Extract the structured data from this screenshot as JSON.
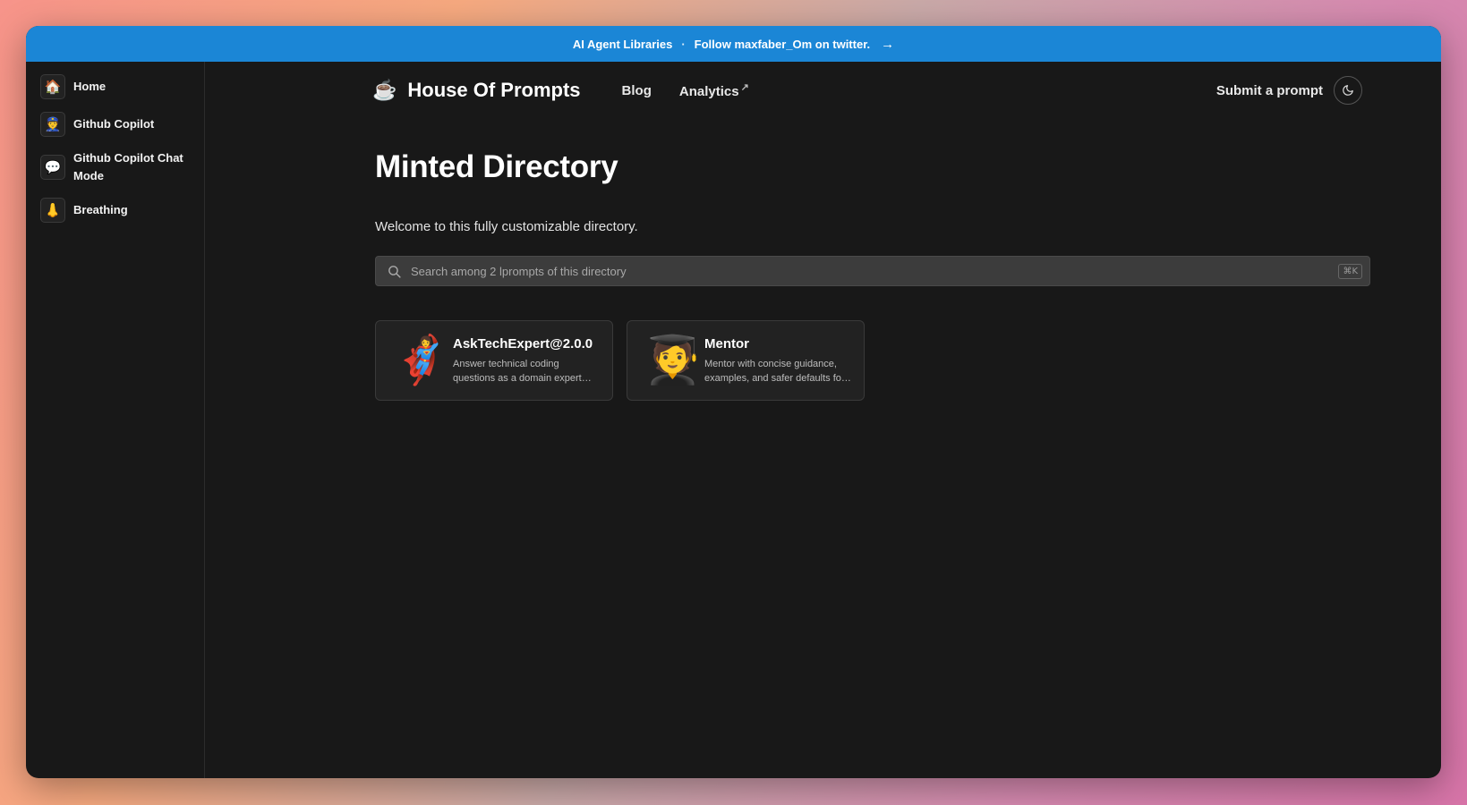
{
  "banner": {
    "library_label": "AI Agent Libraries",
    "separator": "·",
    "follow_text": "Follow maxfaber_Om on twitter.",
    "arrow": "→"
  },
  "sidebar": {
    "items": [
      {
        "icon": "🏠",
        "icon_name": "home-icon",
        "label": "Home"
      },
      {
        "icon": "👮",
        "icon_name": "copilot-icon",
        "label": "Github Copilot"
      },
      {
        "icon": "💬",
        "icon_name": "chat-bubble-icon",
        "label": "Github Copilot Chat Mode"
      },
      {
        "icon": "👃",
        "icon_name": "nose-icon",
        "label": "Breathing"
      }
    ]
  },
  "nav": {
    "brand_icon": "☕",
    "brand": "House Of Prompts",
    "links": [
      {
        "label": "Blog"
      },
      {
        "label": "Analytics",
        "external_icon": "↗"
      }
    ],
    "submit_label": "Submit a prompt",
    "theme_icon": "☾"
  },
  "main": {
    "title": "Minted Directory",
    "welcome": "Welcome to this fully customizable directory.",
    "search_placeholder": "Search among 2 lprompts of this directory",
    "search_shortcut": "⌘K"
  },
  "cards": [
    {
      "emoji": "🦸‍♀️",
      "title": "AskTechExpert@2.0.0",
      "description": "Answer technical coding questions as a domain expert with examples"
    },
    {
      "emoji": "🧑‍🎓",
      "title": "Mentor",
      "description": "Mentor with concise guidance, examples, and safer defaults for learners"
    }
  ],
  "colors": {
    "banner": "#1b86d6",
    "background": "#181818",
    "card": "#222222"
  }
}
